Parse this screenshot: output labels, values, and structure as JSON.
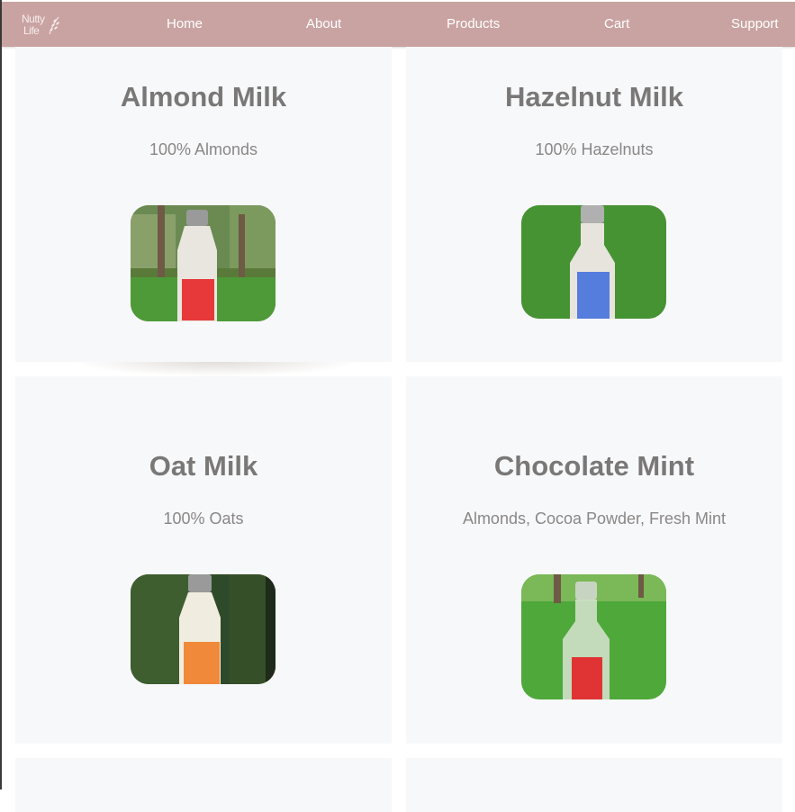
{
  "brand": {
    "logo_line1": "Nutty",
    "logo_line2": "Life"
  },
  "nav": {
    "items": [
      {
        "label": "Home"
      },
      {
        "label": "About"
      },
      {
        "label": "Products"
      },
      {
        "label": "Cart"
      },
      {
        "label": "Support"
      }
    ]
  },
  "colors": {
    "navbar": "#c9a3a2",
    "card_bg": "#f7f8fa",
    "title_text": "#7a7877"
  },
  "products": [
    {
      "name": "Almond Milk",
      "ingredients": "100% Almonds",
      "label_color": "#e8393a"
    },
    {
      "name": "Hazelnut Milk",
      "ingredients": "100% Hazelnuts",
      "label_color": "#4a5fd8"
    },
    {
      "name": "Oat Milk",
      "ingredients": "100% Oats",
      "label_color": "#f08a3a"
    },
    {
      "name": "Chocolate Mint",
      "ingredients": "Almonds, Cocoa Powder, Fresh Mint",
      "label_color": "#e03434"
    }
  ]
}
